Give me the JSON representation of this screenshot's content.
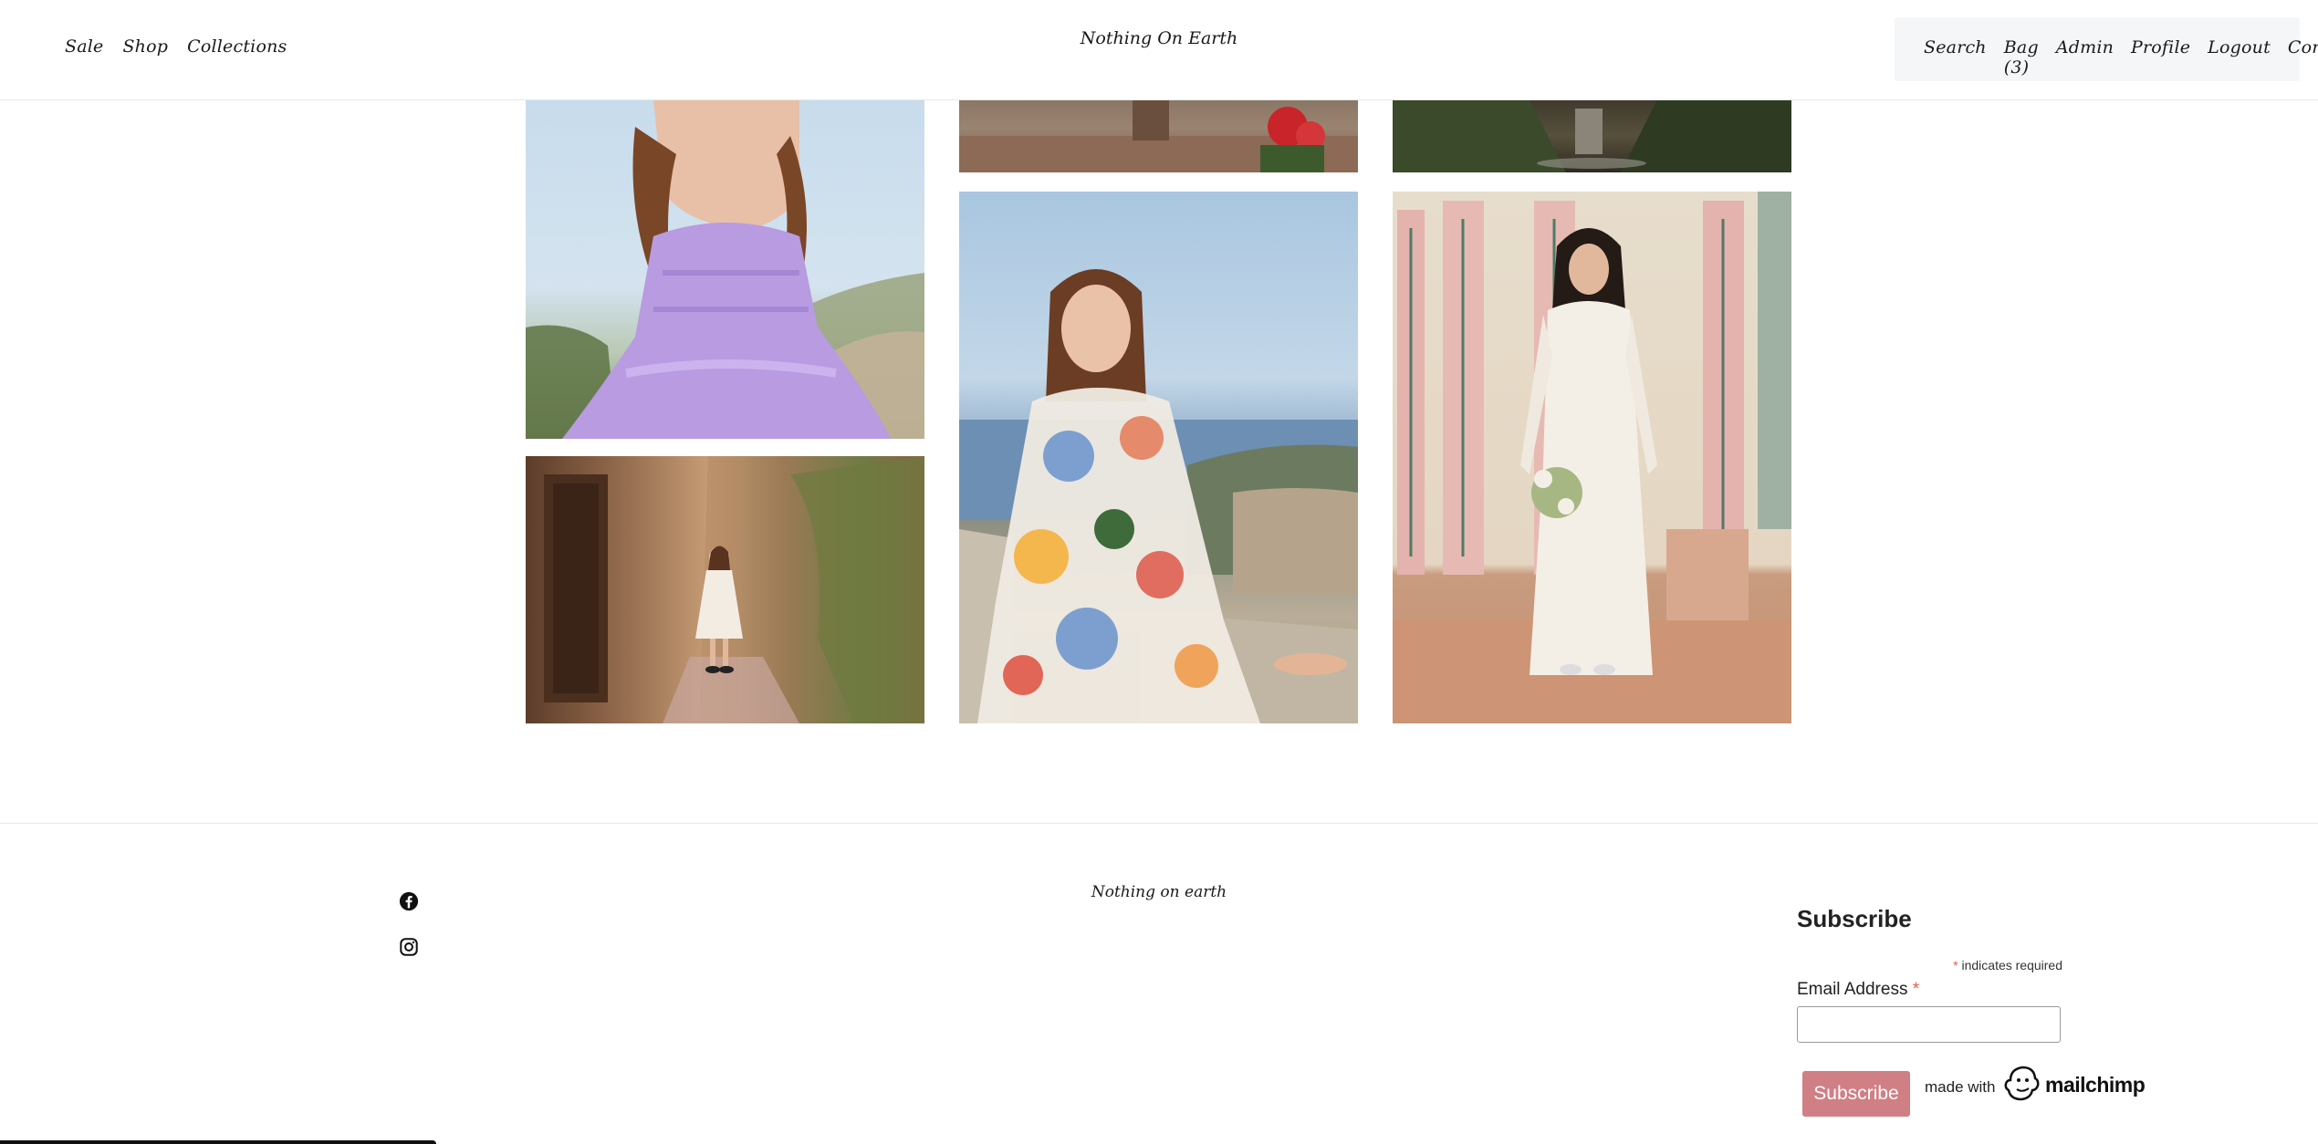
{
  "header": {
    "brand": "Nothing On Earth",
    "nav_left": [
      "Sale",
      "Shop",
      "Collections"
    ],
    "nav_right": [
      "Search",
      "Bag (3)",
      "Admin",
      "Profile",
      "Logout",
      "Contact"
    ]
  },
  "gallery": {
    "photos": [
      {
        "name": "lilac-dress-photo",
        "icon": "photo"
      },
      {
        "name": "terrace-flowers-photo",
        "icon": "photo"
      },
      {
        "name": "wet-street-photo",
        "icon": "photo"
      },
      {
        "name": "stone-alley-photo",
        "icon": "photo"
      },
      {
        "name": "floral-dress-photo",
        "icon": "photo"
      },
      {
        "name": "white-dress-doors-photo",
        "icon": "photo"
      }
    ]
  },
  "footer": {
    "brand": "Nothing on earth",
    "social": [
      "facebook-icon",
      "instagram-icon"
    ],
    "subscribe": {
      "title": "Subscribe",
      "asterisk": "*",
      "required_note": "indicates required",
      "email_label": "Email Address",
      "email_value": "",
      "button_label": "Subscribe",
      "made_with": "made with",
      "mailchimp": "mailchimp"
    }
  },
  "colors": {
    "subscribe_button": "#d07f85",
    "required_asterisk": "#e85c41",
    "header_right_bg": "#f5f6f8"
  }
}
